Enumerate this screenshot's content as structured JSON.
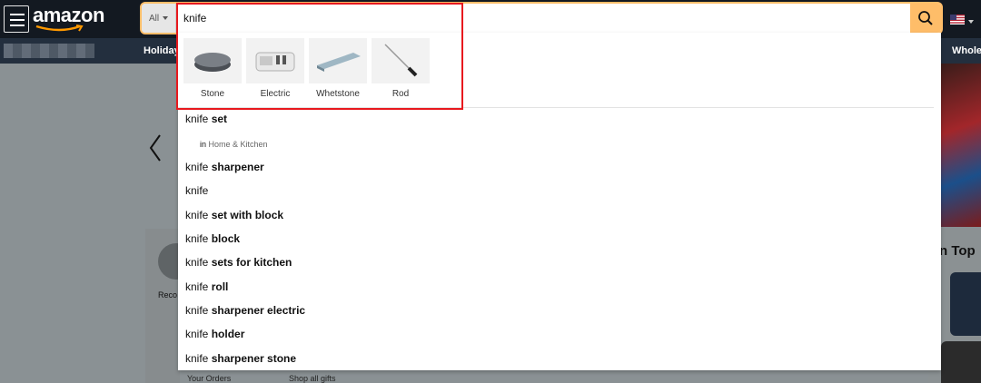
{
  "header": {
    "logo": "amazon",
    "search": {
      "category": "All",
      "query": "knife"
    },
    "subnav": {
      "left_item": "Holiday",
      "right_item": "Whole"
    }
  },
  "dropdown": {
    "thumbnails": [
      {
        "label": "Stone",
        "icon": "sharpening-stone-icon"
      },
      {
        "label": "Electric",
        "icon": "electric-sharpener-icon"
      },
      {
        "label": "Whetstone",
        "icon": "whetstone-icon"
      },
      {
        "label": "Rod",
        "icon": "honing-rod-icon"
      }
    ],
    "suggestions": [
      {
        "prefix": "knife",
        "bold": " set"
      },
      {
        "prefix": "knife",
        "bold": " sharpener"
      },
      {
        "prefix": "knife",
        "bold": ""
      },
      {
        "prefix": "knife",
        "bold": " set with block"
      },
      {
        "prefix": "knife",
        "bold": " block"
      },
      {
        "prefix": "knife",
        "bold": " sets for kitchen"
      },
      {
        "prefix": "knife",
        "bold": " roll"
      },
      {
        "prefix": "knife",
        "bold": " sharpener electric"
      },
      {
        "prefix": "knife",
        "bold": " holder"
      },
      {
        "prefix": "knife",
        "bold": " sharpener stone"
      }
    ],
    "department": {
      "in": "in",
      "name": "Home & Kitchen"
    }
  },
  "page": {
    "reco_text": "Reco",
    "right_card_text": "n Top",
    "bottom_links": [
      "Your Orders",
      "Shop all gifts"
    ]
  },
  "colors": {
    "header_bg": "#131921",
    "subnav_bg": "#232f3e",
    "search_button": "#febd69",
    "highlight": "#e8191e"
  }
}
